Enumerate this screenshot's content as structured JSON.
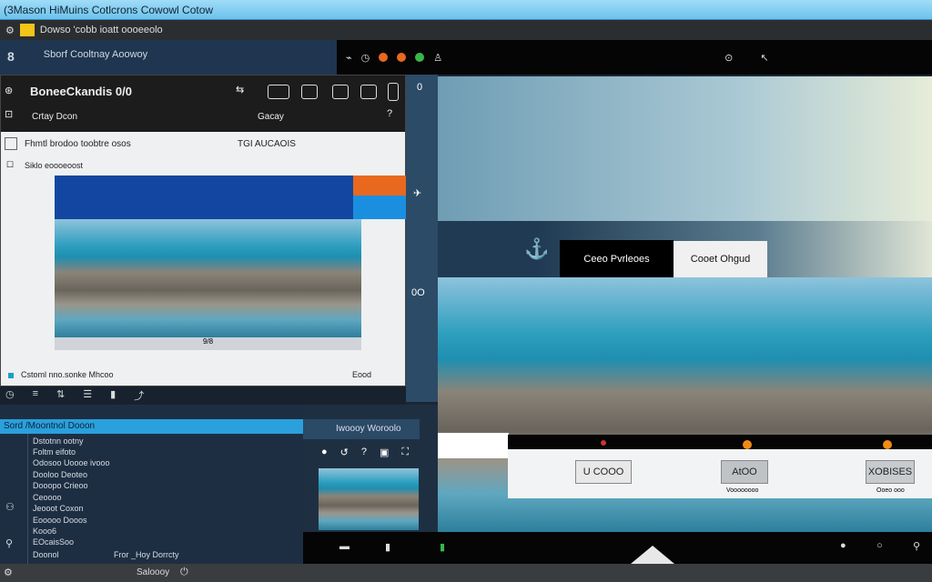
{
  "window_title": "(3Mason HiMuins Cotlcrons Cowowl Cotow",
  "menubar": {
    "text": "Dowso 'cobb ioatt oooeeolo"
  },
  "nav": {
    "icon_label": "8",
    "title": "Sborf Cooltnay Aoowoy"
  },
  "panel": {
    "title": "BoneeCkandis 0/0",
    "subtitle": "Crtay Dcon",
    "subtitle_right": "Gacay",
    "row1_left": "Fhmtl brodoo toobtre osos",
    "row1_right": "TGI AUCAOIS",
    "row2": "Siklo eoooeoost",
    "image_caption": "9/8",
    "footer_left": "Cstoml nno.sonke Mhcoo",
    "footer_right": "Eood"
  },
  "list": {
    "header": "Sord /Moontnol Dooon",
    "items": [
      "Dstotnn ootny",
      "Foltm eifoto",
      "Odosoo Uoooe ivooo",
      "Dooloo Deoteo",
      "Dooopo Crieoo",
      "Ceoooo",
      "Jeooot Coxon",
      "Eooooo Dooos",
      "Kooo6",
      "EOcaisSoo"
    ],
    "footer_left": "Doonol",
    "footer_right": "Fror _Hoy Dorrcty"
  },
  "thumb_panel": {
    "title": "Iwoooy Woroolo"
  },
  "viewer": {
    "button_dark": "Ceeo Pvrleoes",
    "button_light": "Cooet Ohgud"
  },
  "dialog": {
    "buttons": [
      {
        "label": "U COOO",
        "caption": ""
      },
      {
        "label": "AtOO",
        "caption": "Voooooooo"
      },
      {
        "label": "XOBISES",
        "caption": "Ooeo ooo"
      }
    ]
  },
  "statusbar": {
    "text": "Saloooy"
  },
  "colors": {
    "accent": "#2aa0dc",
    "orange": "#e8681f",
    "title_blue": "#7cc8ee"
  }
}
